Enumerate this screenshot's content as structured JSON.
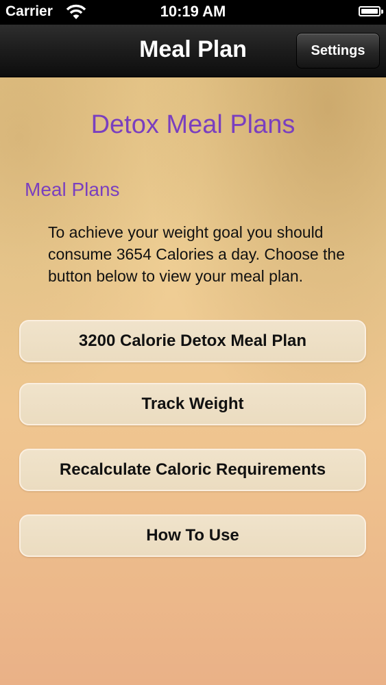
{
  "status_bar": {
    "carrier": "Carrier",
    "time": "10:19 AM",
    "wifi_icon": "wifi-icon",
    "battery_icon": "battery-icon"
  },
  "nav": {
    "title": "Meal Plan",
    "settings_label": "Settings"
  },
  "main": {
    "heading": "Detox Meal Plans",
    "subheading": "Meal Plans",
    "description": "To achieve your weight goal you should consume 3654 Calories a day. Choose the button below to view your meal plan.",
    "buttons": [
      {
        "label": "3200 Calorie Detox Meal Plan"
      },
      {
        "label": "Track Weight"
      },
      {
        "label": "Recalculate Caloric Requirements"
      },
      {
        "label": "How To Use"
      }
    ]
  },
  "colors": {
    "heading": "#7a3fbf",
    "nav_bg": "#1c1c1c",
    "button_bg": "#f0e3cb"
  }
}
